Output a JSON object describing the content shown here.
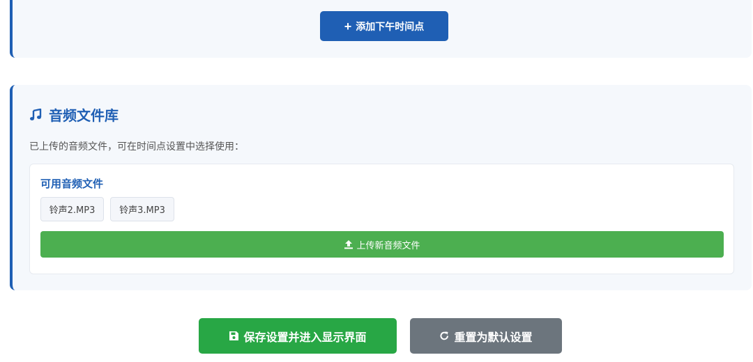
{
  "top_section": {
    "add_afternoon_label": "添加下午时间点"
  },
  "audio_library": {
    "title": "音频文件库",
    "description": "已上传的音频文件，可在时间点设置中选择使用：",
    "available_title": "可用音频文件",
    "files": [
      "铃声2.MP3",
      "铃声3.MP3"
    ],
    "upload_label": "上传新音频文件"
  },
  "actions": {
    "save_label": "保存设置并进入显示界面",
    "reset_label": "重置为默认设置"
  },
  "colors": {
    "primary": "#1f5fb4",
    "success": "#28a745",
    "upload": "#4caf50",
    "secondary": "#6c757d",
    "section_bg": "#f5f8fc"
  },
  "icons": {
    "add": "plus-icon",
    "music": "music-note-icon",
    "upload": "upload-icon",
    "save": "floppy-disk-icon",
    "reset": "redo-icon"
  }
}
